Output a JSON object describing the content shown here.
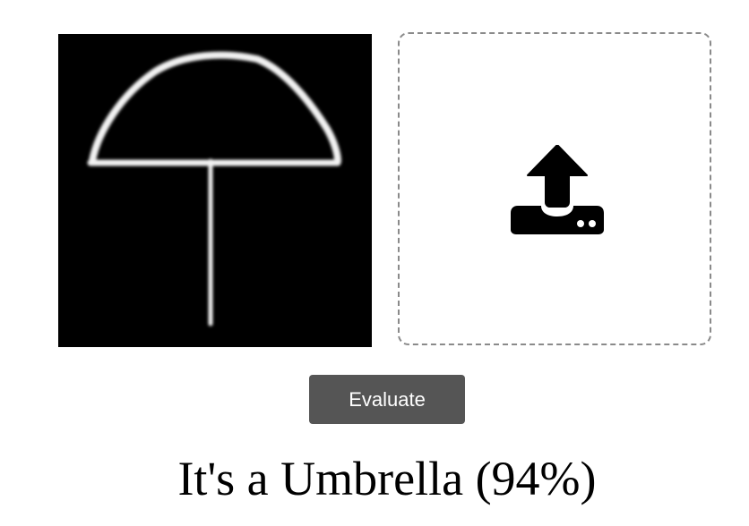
{
  "preview": {
    "image_subject": "umbrella sketch",
    "background_color": "#000000",
    "stroke_color": "#ffffff"
  },
  "upload": {
    "icon": "upload-icon",
    "border_color": "#8a8a8a",
    "icon_color": "#000000"
  },
  "evaluate": {
    "label": "Evaluate",
    "background_color": "#555555",
    "text_color": "#ffffff"
  },
  "result": {
    "text": "It's a Umbrella (94%)"
  }
}
